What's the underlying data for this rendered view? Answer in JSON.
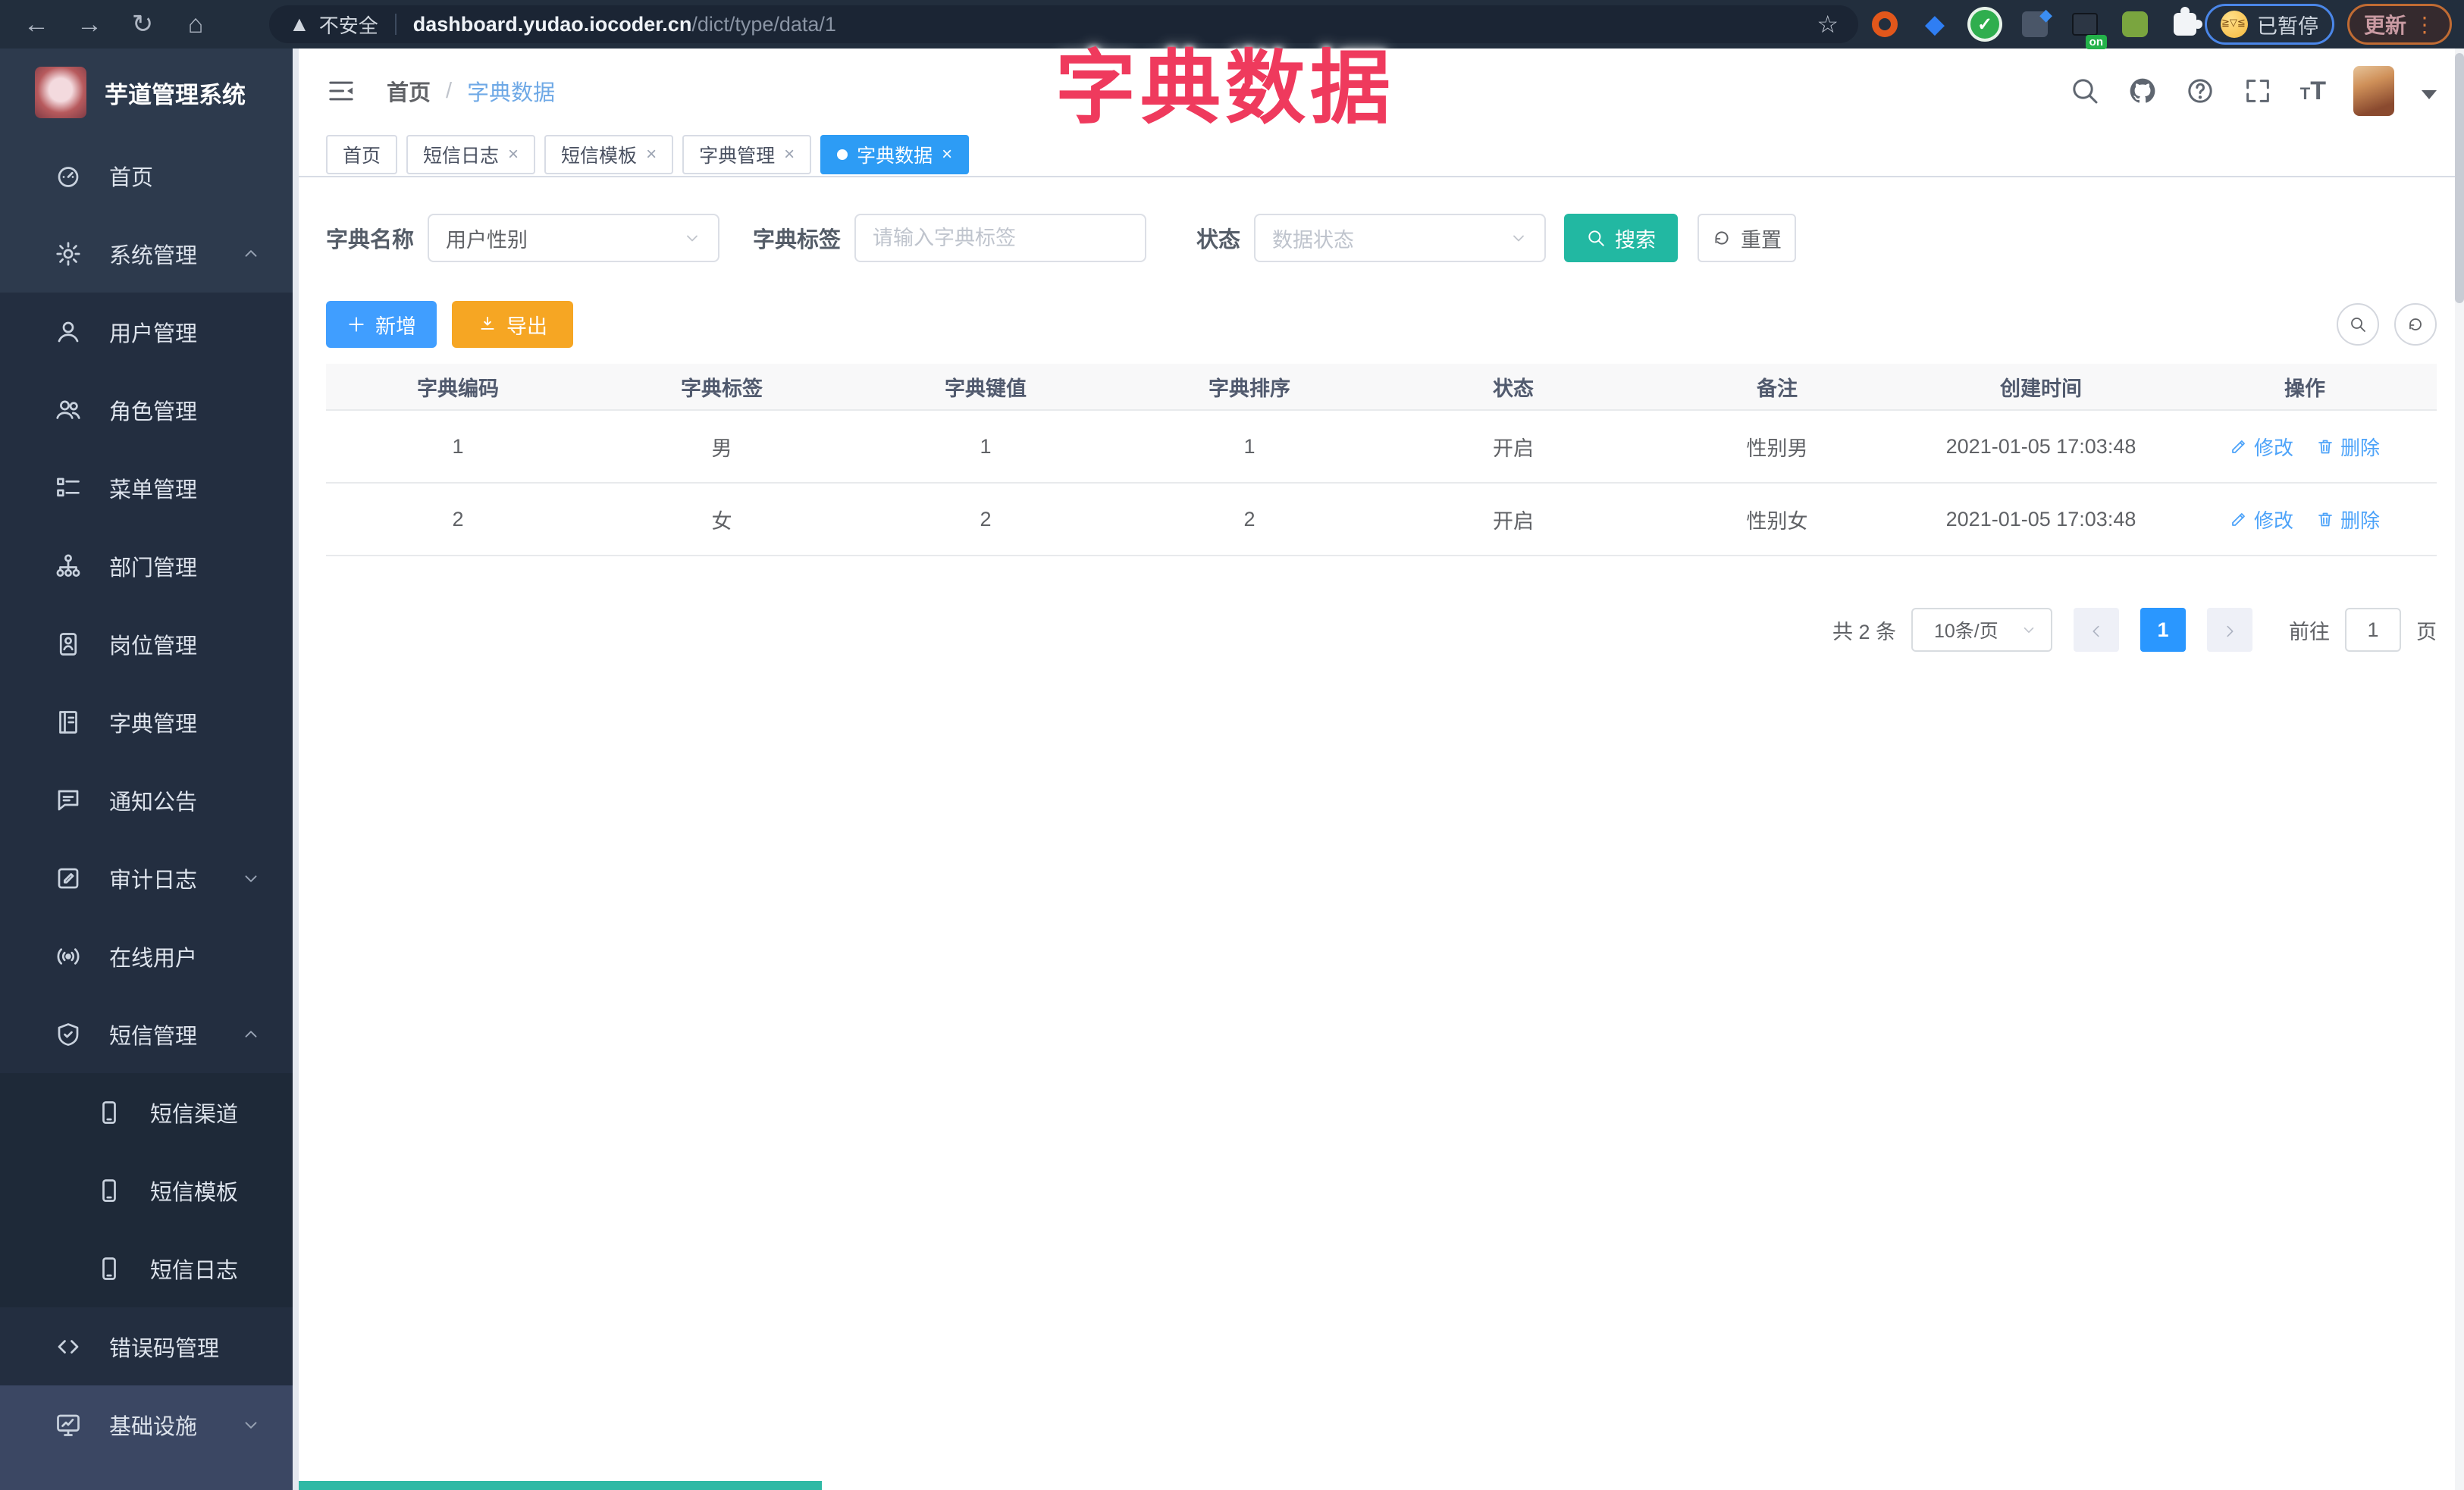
{
  "browser": {
    "security_label": "不安全",
    "url_domain": "dashboard.yudao.iocoder.cn",
    "url_path": "/dict/type/data/1",
    "paused_badge": "已暂停",
    "update_badge": "更新"
  },
  "overlay_title": "字典数据",
  "colors": {
    "accent_blue": "#409eff",
    "tab_active_blue": "#2d9cf5",
    "search_teal": "#22b8a2",
    "export_orange": "#f6a623",
    "title_pink": "#ef3a5d",
    "sidebar_bg": "#2d3a4d",
    "submenu_bg": "#232e40"
  },
  "sidebar": {
    "logo_title": "芋道管理系统",
    "items": [
      {
        "label": "首页",
        "icon": "dashboard-icon",
        "level": 1
      },
      {
        "label": "系统管理",
        "icon": "gear-icon",
        "level": 1,
        "chevron": "up"
      },
      {
        "label": "用户管理",
        "icon": "user-icon",
        "level": 2
      },
      {
        "label": "角色管理",
        "icon": "users-icon",
        "level": 2
      },
      {
        "label": "菜单管理",
        "icon": "menu-list-icon",
        "level": 2
      },
      {
        "label": "部门管理",
        "icon": "org-tree-icon",
        "level": 2
      },
      {
        "label": "岗位管理",
        "icon": "id-badge-icon",
        "level": 2
      },
      {
        "label": "字典管理",
        "icon": "book-icon",
        "level": 2
      },
      {
        "label": "通知公告",
        "icon": "announcement-icon",
        "level": 2
      },
      {
        "label": "审计日志",
        "icon": "log-icon",
        "level": 2,
        "chevron": "down"
      },
      {
        "label": "在线用户",
        "icon": "online-icon",
        "level": 2
      },
      {
        "label": "短信管理",
        "icon": "shield-icon",
        "level": 2,
        "chevron": "up"
      },
      {
        "label": "短信渠道",
        "icon": "phone-icon",
        "level": 3
      },
      {
        "label": "短信模板",
        "icon": "phone-icon",
        "level": 3
      },
      {
        "label": "短信日志",
        "icon": "phone-icon",
        "level": 3
      },
      {
        "label": "错误码管理",
        "icon": "code-icon",
        "level": 2
      },
      {
        "label": "基础设施",
        "icon": "monitor-icon",
        "level": 1,
        "chevron": "down",
        "highlight": true
      }
    ]
  },
  "header": {
    "breadcrumb": [
      "首页",
      "字典数据"
    ]
  },
  "tabs": [
    {
      "label": "首页",
      "closable": false,
      "active": false
    },
    {
      "label": "短信日志",
      "closable": true,
      "active": false
    },
    {
      "label": "短信模板",
      "closable": true,
      "active": false
    },
    {
      "label": "字典管理",
      "closable": true,
      "active": false
    },
    {
      "label": "字典数据",
      "closable": true,
      "active": true
    }
  ],
  "filters": {
    "dict_name_label": "字典名称",
    "dict_name_value": "用户性别",
    "dict_label_label": "字典标签",
    "dict_label_placeholder": "请输入字典标签",
    "status_label": "状态",
    "status_placeholder": "数据状态",
    "search_label": "搜索",
    "reset_label": "重置"
  },
  "toolbar": {
    "add_label": "新增",
    "export_label": "导出"
  },
  "table": {
    "headers": [
      "字典编码",
      "字典标签",
      "字典键值",
      "字典排序",
      "状态",
      "备注",
      "创建时间",
      "操作"
    ],
    "rows": [
      {
        "code": "1",
        "label": "男",
        "value": "1",
        "sort": "1",
        "status": "开启",
        "remark": "性别男",
        "created": "2021-01-05 17:03:48"
      },
      {
        "code": "2",
        "label": "女",
        "value": "2",
        "sort": "2",
        "status": "开启",
        "remark": "性别女",
        "created": "2021-01-05 17:03:48"
      }
    ],
    "edit_label": "修改",
    "delete_label": "删除"
  },
  "pagination": {
    "total": "共 2 条",
    "page_size": "10条/页",
    "current": "1",
    "goto_label": "前往",
    "page_unit": "页"
  }
}
